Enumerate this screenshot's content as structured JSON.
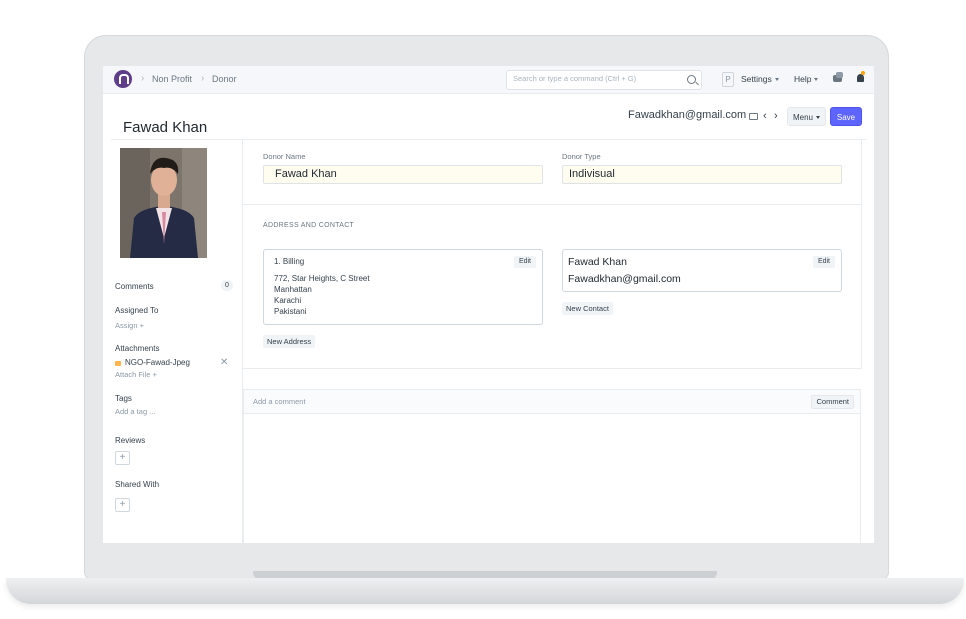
{
  "navbar": {
    "breadcrumbs": [
      "Non Profit",
      "Donor"
    ],
    "search_placeholder": "Search or type a command (Ctrl + G)",
    "p_badge": "P",
    "settings_label": "Settings",
    "help_label": "Help"
  },
  "header": {
    "title": "Fawad Khan",
    "email": "Fawadkhan@gmail.com",
    "prev_glyph": "‹",
    "next_glyph": "›",
    "menu_label": "Menu",
    "save_label": "Save"
  },
  "sidebar": {
    "comments_label": "Comments",
    "comments_count": "0",
    "assigned_to_label": "Assigned To",
    "assign_label": "Assign +",
    "attachments_label": "Attachments",
    "attachment_name": "NGO-Fawad-Jpeg",
    "attach_file_label": "Attach File +",
    "tags_label": "Tags",
    "add_tag_label": "Add a tag ...",
    "reviews_label": "Reviews",
    "shared_with_label": "Shared With",
    "plus_glyph": "+",
    "remove_glyph": "✕"
  },
  "form": {
    "donor_name_label": "Donor Name",
    "donor_name_value": "Fawad Khan",
    "donor_type_label": "Donor Type",
    "donor_type_value": "Indivisual",
    "address_section_title": "ADDRESS AND CONTACT",
    "address": {
      "heading": "1. Billing",
      "edit_label": "Edit",
      "lines": [
        "772, Star Heights, C Street",
        "Manhattan",
        "Karachi",
        "Pakistani"
      ]
    },
    "new_address_label": "New Address",
    "contact": {
      "name": "Fawad Khan",
      "email": "Fawadkhan@gmail.com",
      "edit_label": "Edit"
    },
    "new_contact_label": "New Contact"
  },
  "comment": {
    "placeholder": "Add a comment",
    "button_label": "Comment"
  },
  "colors": {
    "primary": "#5e64ff",
    "logo": "#5e3d8b",
    "field_background": "#fffdf0",
    "notification_dot": "#ffa00a"
  }
}
